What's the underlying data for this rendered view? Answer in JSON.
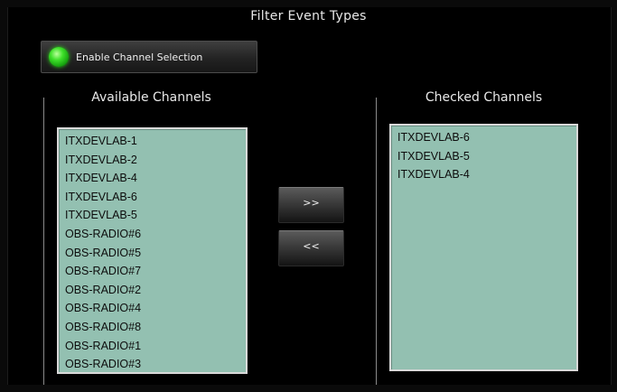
{
  "dialog": {
    "title": "Filter Event Types"
  },
  "enable_button": {
    "label": "Enable Channel Selection",
    "led_color": "#3ee02a",
    "state": "on"
  },
  "available": {
    "title": "Available Channels",
    "items": [
      "ITXDEVLAB-1",
      "ITXDEVLAB-2",
      "ITXDEVLAB-4",
      "ITXDEVLAB-6",
      "ITXDEVLAB-5",
      "OBS-RADIO#6",
      "OBS-RADIO#5",
      "OBS-RADIO#7",
      "OBS-RADIO#2",
      "OBS-RADIO#4",
      "OBS-RADIO#8",
      "OBS-RADIO#1",
      "OBS-RADIO#3"
    ]
  },
  "checked": {
    "title": "Checked Channels",
    "items": [
      "ITXDEVLAB-6",
      "ITXDEVLAB-5",
      "ITXDEVLAB-4"
    ]
  },
  "buttons": {
    "add_label": ">>",
    "remove_label": "<<"
  },
  "colors": {
    "list_background": "#93c0b1",
    "window_background": "#000000"
  }
}
